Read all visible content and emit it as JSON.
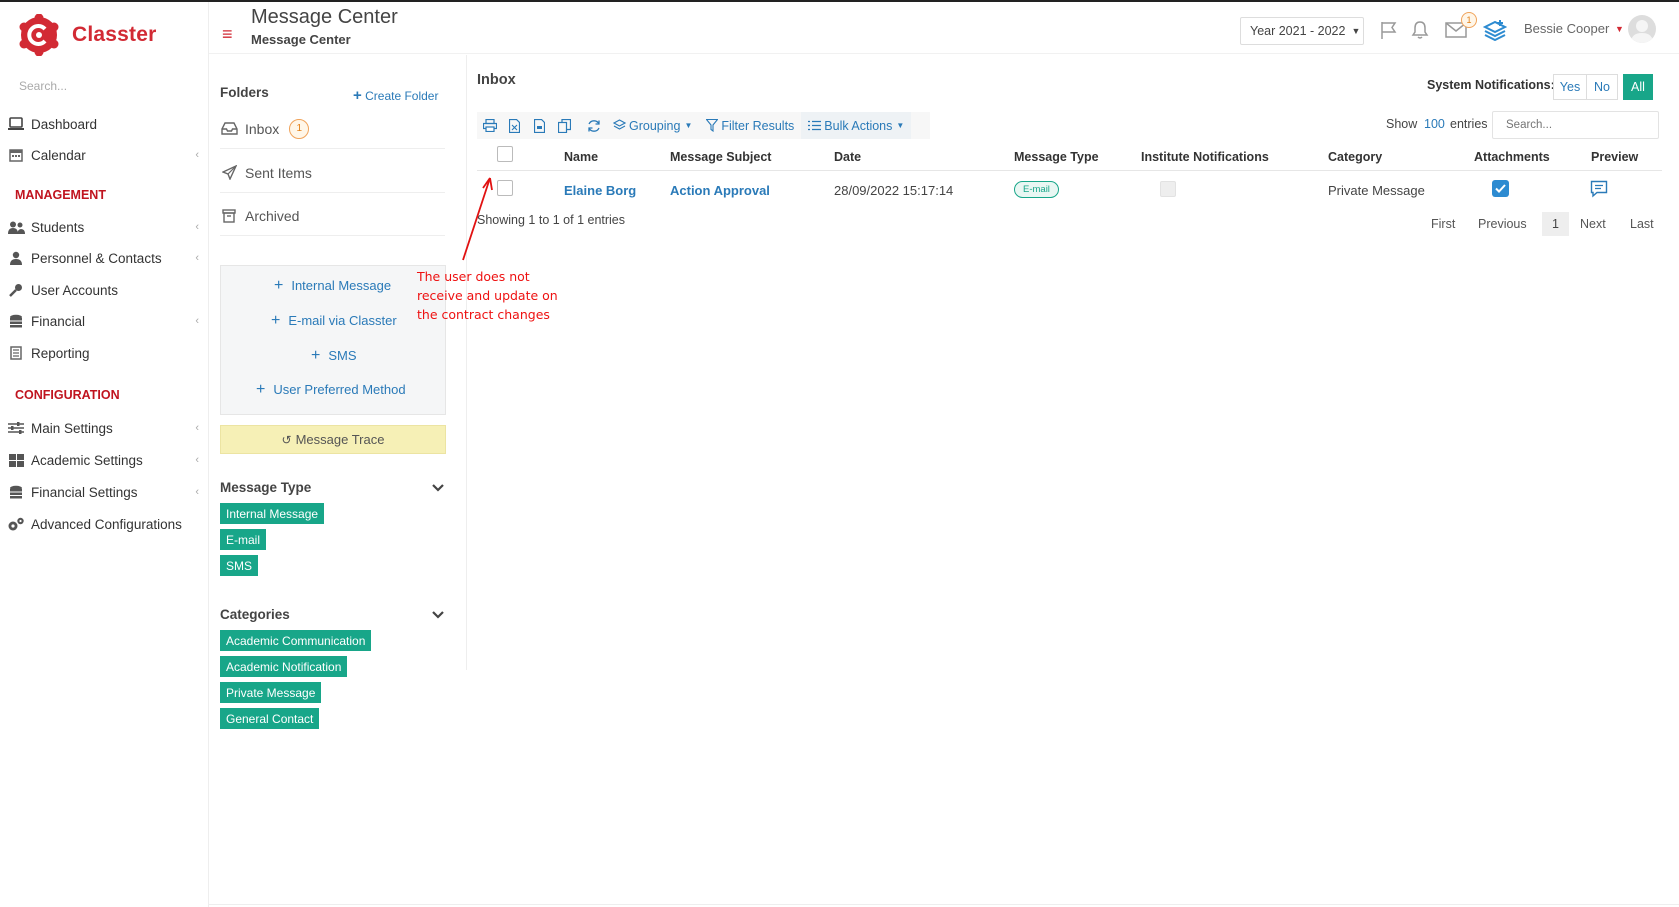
{
  "app": {
    "name": "Classter",
    "brand_color": "#d22a34",
    "accent_color": "#18a689",
    "link_color": "#2a7ab8"
  },
  "sidebar": {
    "search_placeholder": "Search...",
    "items_top": [
      {
        "label": "Dashboard",
        "icon": "laptop-icon"
      },
      {
        "label": "Calendar",
        "icon": "calendar-icon"
      }
    ],
    "section_management": "MANAGEMENT",
    "items_management": [
      {
        "label": "Students",
        "icon": "users-icon"
      },
      {
        "label": "Personnel & Contacts",
        "icon": "user-tie-icon"
      },
      {
        "label": "User Accounts",
        "icon": "key-icon"
      },
      {
        "label": "Financial",
        "icon": "coins-icon"
      },
      {
        "label": "Reporting",
        "icon": "report-icon"
      }
    ],
    "section_configuration": "CONFIGURATION",
    "items_configuration": [
      {
        "label": "Main Settings",
        "icon": "sliders-icon"
      },
      {
        "label": "Academic Settings",
        "icon": "grid-icon"
      },
      {
        "label": "Financial Settings",
        "icon": "coins-icon"
      },
      {
        "label": "Advanced Configurations",
        "icon": "cogs-icon"
      }
    ]
  },
  "header": {
    "title": "Message Center",
    "subtitle": "Message Center",
    "year": "Year 2021 - 2022",
    "mail_count": "1",
    "user_name": "Bessie Cooper"
  },
  "folders": {
    "title": "Folders",
    "create_label": "Create Folder",
    "items": [
      {
        "label": "Inbox",
        "count": "1",
        "icon": "inbox-icon"
      },
      {
        "label": "Sent Items",
        "icon": "paper-plane-icon"
      },
      {
        "label": "Archived",
        "icon": "archive-icon"
      }
    ],
    "compose": [
      "Internal Message",
      "E-mail via Classter",
      "SMS",
      "User Preferred Method"
    ],
    "trace_label": "Message Trace",
    "message_type_title": "Message Type",
    "message_types": [
      "Internal Message",
      "E-mail",
      "SMS"
    ],
    "categories_title": "Categories",
    "categories": [
      "Academic Communication",
      "Academic Notification",
      "Private Message",
      "General Contact"
    ]
  },
  "inbox": {
    "title": "Inbox",
    "system_notifications_label": "System Notifications:",
    "notif_options": [
      "Yes",
      "No",
      "All"
    ],
    "notif_selected": "All",
    "toolbar": {
      "grouping": "Grouping",
      "filter": "Filter Results",
      "bulk": "Bulk Actions"
    },
    "show_label": "Show",
    "show_count": "100",
    "entries_label": "entries",
    "search_placeholder": "Search...",
    "columns": [
      "Name",
      "Message Subject",
      "Date",
      "Message Type",
      "Institute Notifications",
      "Category",
      "Attachments",
      "Preview"
    ],
    "rows": [
      {
        "name": "Elaine Borg",
        "subject": "Action Approval",
        "date": "28/09/2022 15:17:14",
        "type": "E-mail",
        "institute_notification": false,
        "category": "Private Message",
        "attachments": true
      }
    ],
    "showing_text": "Showing 1 to 1 of 1 entries",
    "pager": {
      "first": "First",
      "previous": "Previous",
      "current": "1",
      "next": "Next",
      "last": "Last"
    }
  },
  "annotation": {
    "text": "The user does not receive and update on the contract changes",
    "color": "#e11111"
  }
}
